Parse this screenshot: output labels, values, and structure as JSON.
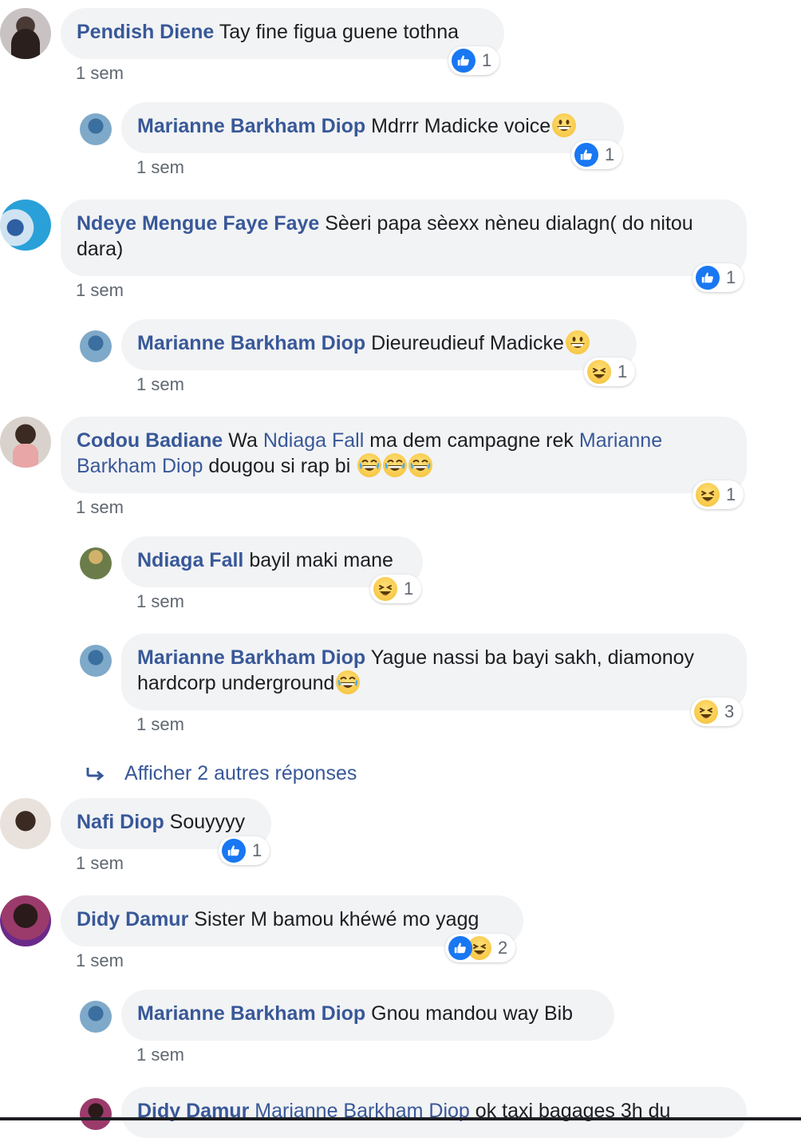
{
  "comments": [
    {
      "author": "Pendish Diene",
      "text": "Tay fine figua guene tothna",
      "time": "1 sem",
      "reaction_count": "1"
    },
    {
      "author": "Marianne Barkham Diop",
      "text": "Mdrrr Madicke voice",
      "time": "1 sem",
      "reaction_count": "1"
    },
    {
      "author": "Ndeye Mengue Faye Faye",
      "text": "Sèeri papa sèexx nèneu dialagn( do nitou dara)",
      "time": "1 sem",
      "reaction_count": "1"
    },
    {
      "author": "Marianne Barkham Diop",
      "text": "Dieureudieuf Madicke",
      "time": "1 sem",
      "reaction_count": "1"
    },
    {
      "author": "Codou Badiane",
      "text_before": "Wa",
      "mention1": "Ndiaga Fall",
      "text_middle": "ma dem campagne rek",
      "mention2": "Marianne Barkham Diop",
      "text_after": "dougou si rap bi",
      "time": "1 sem",
      "reaction_count": "1"
    },
    {
      "author": "Ndiaga Fall",
      "text": "bayil maki mane",
      "time": "1 sem",
      "reaction_count": "1"
    },
    {
      "author": "Marianne Barkham Diop",
      "text": "Yague nassi ba bayi sakh, diamonoy hardcorp underground",
      "time": "1 sem",
      "reaction_count": "3"
    },
    {
      "author": "Nafi Diop",
      "text": "Souyyyy",
      "time": "1 sem",
      "reaction_count": "1"
    },
    {
      "author": "Didy Damur",
      "text": "Sister M bamou khéwé mo yagg",
      "time": "1 sem",
      "reaction_count": "2"
    },
    {
      "author": "Marianne Barkham Diop",
      "text": "Gnou mandou way Bib",
      "time": "1 sem"
    },
    {
      "author": "Didy Damur",
      "mention": "Marianne Barkham Diop",
      "text": "ok taxi bagages 3h du"
    }
  ],
  "more_replies": "Afficher 2 autres réponses",
  "colors": {
    "link": "#385898",
    "bubble": "#f2f3f5",
    "like": "#1877f2",
    "meta": "#606770"
  }
}
